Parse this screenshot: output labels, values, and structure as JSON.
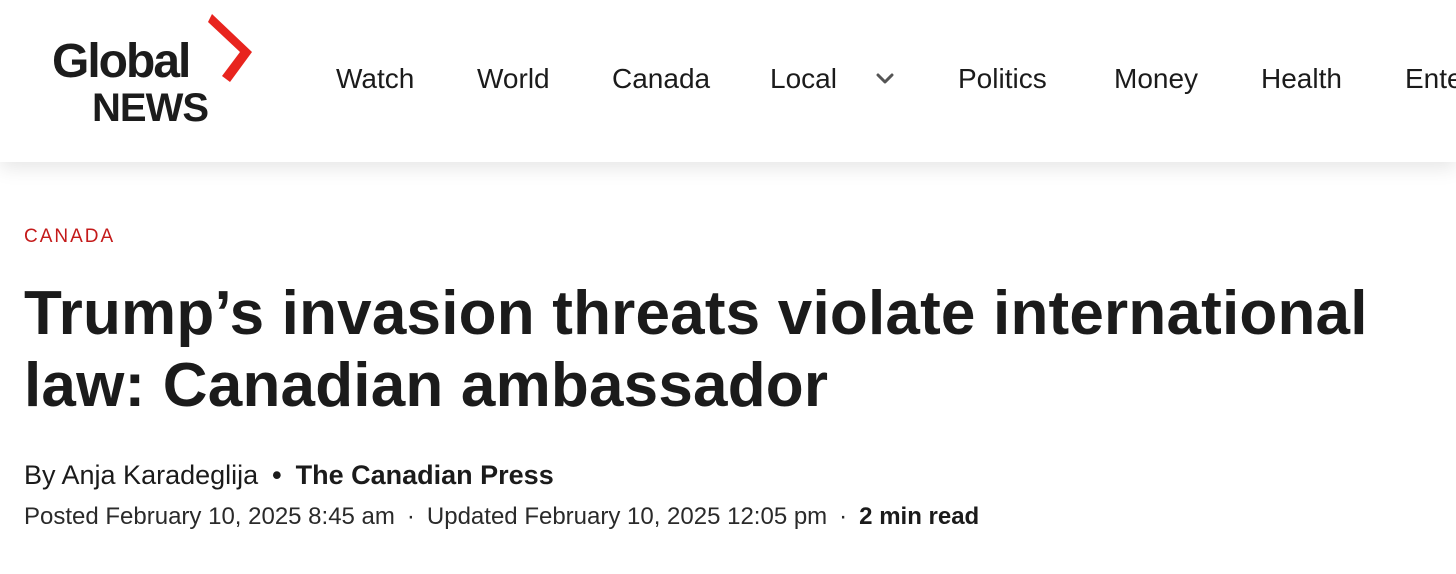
{
  "brand": {
    "logo_top": "Global",
    "logo_bottom": "NEWS",
    "accent_color": "#e8241e"
  },
  "nav": {
    "items": [
      {
        "label": "Watch"
      },
      {
        "label": "World"
      },
      {
        "label": "Canada"
      },
      {
        "label": "Local"
      },
      {
        "label": "Politics"
      },
      {
        "label": "Money"
      },
      {
        "label": "Health"
      },
      {
        "label": "Ente"
      }
    ],
    "local_dropdown_icon": "chevron-down-icon"
  },
  "article": {
    "category": "CANADA",
    "category_color": "#c41a1a",
    "headline": "Trump’s invasion threats violate international law: Canadian ambassador",
    "byline": {
      "prefix": "By Anja Karadeglija",
      "separator": "•",
      "source": "The Canadian Press"
    },
    "meta": {
      "posted": "Posted February 10, 2025 8:45 am",
      "separator": "·",
      "updated": "Updated February 10, 2025 12:05 pm",
      "read_time": "2 min read"
    }
  }
}
